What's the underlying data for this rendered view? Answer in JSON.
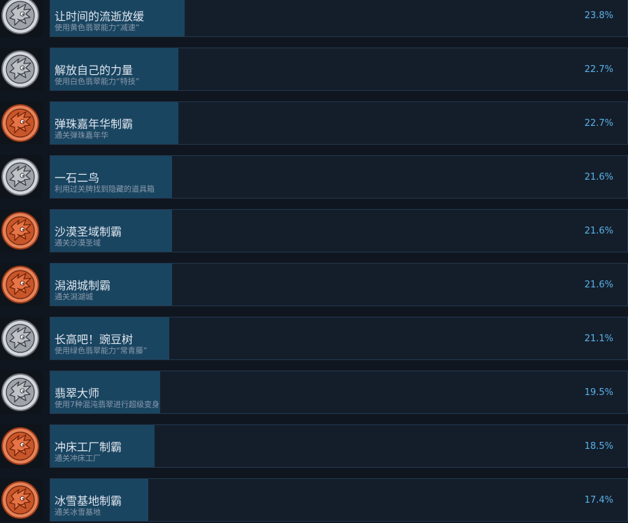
{
  "achievements": [
    {
      "tier": "silver",
      "title": "让时间的流逝放缓",
      "description": "使用黄色翡翠能力“减速”",
      "percent_label": "23.8%",
      "percent": 23.8
    },
    {
      "tier": "silver",
      "title": "解放自己的力量",
      "description": "使用白色翡翠能力“特技”",
      "percent_label": "22.7%",
      "percent": 22.7
    },
    {
      "tier": "bronze",
      "title": "弹珠嘉年华制霸",
      "description": "通关弹珠嘉年华",
      "percent_label": "22.7%",
      "percent": 22.7
    },
    {
      "tier": "silver",
      "title": "一石二鸟",
      "description": "利用过关牌找到隐藏的道具箱",
      "percent_label": "21.6%",
      "percent": 21.6
    },
    {
      "tier": "bronze",
      "title": "沙漠圣域制霸",
      "description": "通关沙漠圣域",
      "percent_label": "21.6%",
      "percent": 21.6
    },
    {
      "tier": "bronze",
      "title": "潟湖城制霸",
      "description": "通关潟湖城",
      "percent_label": "21.6%",
      "percent": 21.6
    },
    {
      "tier": "silver",
      "title": "长高吧！豌豆树",
      "description": "使用绿色翡翠能力“常青藤”",
      "percent_label": "21.1%",
      "percent": 21.1
    },
    {
      "tier": "silver",
      "title": "翡翠大师",
      "description": "使用7种混沌翡翠进行超级变身",
      "percent_label": "19.5%",
      "percent": 19.5
    },
    {
      "tier": "bronze",
      "title": "冲床工厂制霸",
      "description": "通关冲床工厂",
      "percent_label": "18.5%",
      "percent": 18.5
    },
    {
      "tier": "bronze",
      "title": "冰雪基地制霸",
      "description": "通关冰雪基地",
      "percent_label": "17.4%",
      "percent": 17.4
    }
  ],
  "colors": {
    "page_background": "#10161f",
    "card_background": "#141e2b",
    "progress_fill": "#1a4561",
    "title_text": "#dfe6ee",
    "description_text": "#8a9aab",
    "percent_text": "#5ab2e8",
    "silver_medal": "#c3c7cc",
    "bronze_medal": "#e0703d"
  },
  "icon_names": {
    "silver": "silver-medal-icon",
    "bronze": "bronze-medal-icon"
  }
}
